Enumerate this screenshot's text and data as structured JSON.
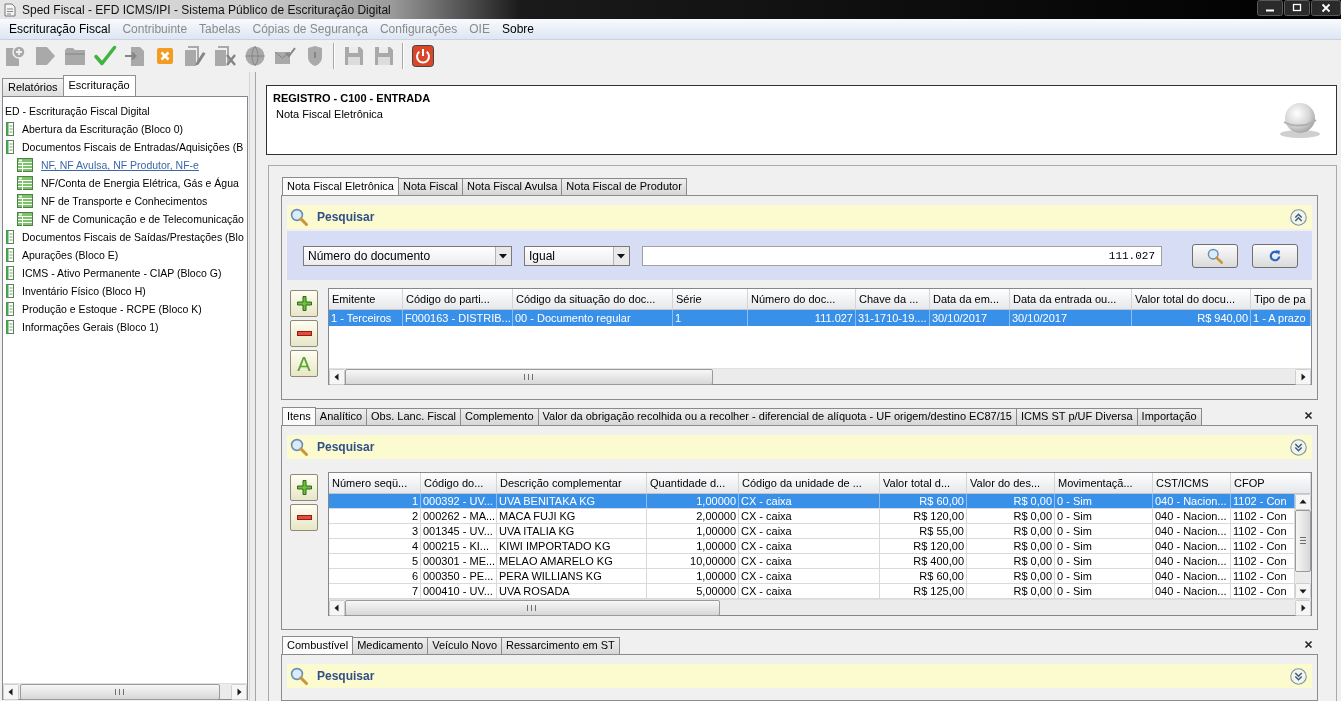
{
  "window": {
    "title": "Sped Fiscal - EFD ICMS/IPI - Sistema Público de Escrituração Digital"
  },
  "menu": [
    {
      "label": "Escrituração Fiscal",
      "disabled": false
    },
    {
      "label": "Contribuinte",
      "disabled": true
    },
    {
      "label": "Tabelas",
      "disabled": true
    },
    {
      "label": "Cópias de Segurança",
      "disabled": true
    },
    {
      "label": "Configurações",
      "disabled": true
    },
    {
      "label": "OIE",
      "disabled": true
    },
    {
      "label": "Sobre",
      "disabled": false
    }
  ],
  "toolbar": [
    {
      "buttons": [
        {
          "kind": "new",
          "disabled": true
        },
        {
          "kind": "forward",
          "disabled": true
        },
        {
          "kind": "folder",
          "disabled": true
        },
        {
          "kind": "check",
          "disabled": false
        },
        {
          "kind": "import",
          "disabled": true
        },
        {
          "kind": "cancel",
          "disabled": false
        },
        {
          "kind": "edit",
          "disabled": true
        },
        {
          "kind": "delete",
          "disabled": true
        },
        {
          "kind": "globe",
          "disabled": true
        },
        {
          "kind": "mail",
          "disabled": true
        },
        {
          "kind": "shield",
          "disabled": true
        }
      ]
    },
    {
      "buttons": [
        {
          "kind": "save",
          "disabled": true
        },
        {
          "kind": "save",
          "disabled": true
        }
      ]
    },
    {
      "buttons": [
        {
          "kind": "power",
          "disabled": false
        }
      ]
    }
  ],
  "left_panel": {
    "tabs": [
      {
        "label": "Relatórios",
        "selected": false
      },
      {
        "label": "Escrituração",
        "selected": true
      }
    ],
    "tree": [
      {
        "label": "ED - Escrituração Fiscal Digital",
        "selected": false,
        "children": [
          {
            "label": "Abertura da Escrituração (Bloco 0)",
            "selected": false
          },
          {
            "label": "Documentos Fiscais de Entradas/Aquisições (B",
            "selected": false,
            "children": [
              {
                "label": "NF, NF Avulsa, NF Produtor, NF-e",
                "selected": true
              },
              {
                "label": "NF/Conta de Energia Elétrica, Gás e Água",
                "selected": false
              },
              {
                "label": "NF de Transporte e Conhecimentos",
                "selected": false
              },
              {
                "label": "NF de Comunicação e de Telecomunicação",
                "selected": false
              }
            ]
          },
          {
            "label": "Documentos Fiscais de Saídas/Prestações (Blo",
            "selected": false
          },
          {
            "label": "Apurações (Bloco E)",
            "selected": false
          },
          {
            "label": "ICMS - Ativo Permanente - CIAP (Bloco G)",
            "selected": false
          },
          {
            "label": "Inventário Físico (Bloco H)",
            "selected": false
          },
          {
            "label": "Produção e Estoque - RCPE (Bloco K)",
            "selected": false
          },
          {
            "label": "Informações Gerais (Bloco 1)",
            "selected": false
          }
        ]
      }
    ]
  },
  "record_header": {
    "title": "REGISTRO - C100 - ENTRADA",
    "subtitle": "Nota Fiscal Eletrônica"
  },
  "document_section": {
    "tabs": [
      {
        "label": "Nota Fiscal Eletrônica",
        "selected": true
      },
      {
        "label": "Nota Fiscal",
        "selected": false
      },
      {
        "label": "Nota Fiscal Avulsa",
        "selected": false
      },
      {
        "label": "Nota Fiscal de Produtor",
        "selected": false
      }
    ],
    "search": {
      "label": "Pesquisar",
      "expanded": true,
      "field": "Número do documento",
      "operator": "Igual",
      "value": "111.027"
    },
    "row_buttons": [
      {
        "kind": "add"
      },
      {
        "kind": "remove"
      },
      {
        "kind": "letter",
        "label": "A"
      }
    ],
    "table": {
      "columns": [
        "Emitente",
        "Código do parti...",
        "Código da situação do doc...",
        "Série",
        "Número do doc...",
        "Chave da ...",
        "Data da em...",
        "Data da entrada ou...",
        "Valor total do docu...",
        "Tipo de pa"
      ],
      "rows": [
        {
          "selected": true,
          "cells": [
            "1 - Terceiros",
            "F000163 - DISTRIB...",
            "00 - Documento regular",
            "1",
            "111.027",
            "31-1710-19....",
            "30/10/2017",
            "30/10/2017",
            "R$ 940,00",
            "1 - A prazo"
          ]
        }
      ]
    }
  },
  "items_section": {
    "tabs": [
      {
        "label": "Itens",
        "selected": true
      },
      {
        "label": "Analítico",
        "selected": false
      },
      {
        "label": "Obs. Lanc. Fiscal",
        "selected": false
      },
      {
        "label": "Complemento",
        "selected": false
      },
      {
        "label": "Valor da obrigação recolhida ou a recolher - diferencial de alíquota - UF origem/destino EC87/15",
        "selected": false
      },
      {
        "label": "ICMS ST p/UF Diversa",
        "selected": false
      },
      {
        "label": "Importação",
        "selected": false
      }
    ],
    "search": {
      "label": "Pesquisar",
      "expanded": false
    },
    "row_buttons": [
      {
        "kind": "add"
      },
      {
        "kind": "remove"
      }
    ],
    "table": {
      "columns": [
        "Número seqü...",
        "Código do...",
        "Descrição complementar",
        "Quantidade d...",
        "Código da unidade de ...",
        "Valor total d...",
        "Valor do des...",
        "Movimentaçã...",
        "CST/ICMS",
        "CFOP"
      ],
      "rows": [
        {
          "selected": true,
          "cells": [
            "1",
            "000392 - UV...",
            "UVA BENITAKA KG",
            "1,00000",
            "CX - caixa",
            "R$ 60,00",
            "R$ 0,00",
            "0 - Sim",
            "040 - Nacion...",
            "1102 - Con"
          ]
        },
        {
          "selected": false,
          "cells": [
            "2",
            "000262 - MA...",
            "MACA FUJI KG",
            "2,00000",
            "CX - caixa",
            "R$ 120,00",
            "R$ 0,00",
            "0 - Sim",
            "040 - Nacion...",
            "1102 - Con"
          ]
        },
        {
          "selected": false,
          "cells": [
            "3",
            "001345 - UV...",
            "UVA ITALIA KG",
            "1,00000",
            "CX - caixa",
            "R$ 55,00",
            "R$ 0,00",
            "0 - Sim",
            "040 - Nacion...",
            "1102 - Con"
          ]
        },
        {
          "selected": false,
          "cells": [
            "4",
            "000215 - KI...",
            "KIWI IMPORTADO KG",
            "1,00000",
            "CX - caixa",
            "R$ 120,00",
            "R$ 0,00",
            "0 - Sim",
            "040 - Nacion...",
            "1102 - Con"
          ]
        },
        {
          "selected": false,
          "cells": [
            "5",
            "000301 - ME...",
            "MELAO AMARELO KG",
            "10,00000",
            "CX - caixa",
            "R$ 400,00",
            "R$ 0,00",
            "0 - Sim",
            "040 - Nacion...",
            "1102 - Con"
          ]
        },
        {
          "selected": false,
          "cells": [
            "6",
            "000350 - PE...",
            "PERA WILLIANS KG",
            "1,00000",
            "CX - caixa",
            "R$ 60,00",
            "R$ 0,00",
            "0 - Sim",
            "040 - Nacion...",
            "1102 - Con"
          ]
        },
        {
          "selected": false,
          "cells": [
            "7",
            "000410 - UV...",
            "UVA ROSADA",
            "5,00000",
            "CX - caixa",
            "R$ 125,00",
            "R$ 0,00",
            "0 - Sim",
            "040 - Nacion...",
            "1102 - Con"
          ]
        }
      ]
    }
  },
  "detail_section": {
    "tabs": [
      {
        "label": "Combustível",
        "selected": true
      },
      {
        "label": "Medicamento",
        "selected": false
      },
      {
        "label": "Veículo Novo",
        "selected": false
      },
      {
        "label": "Ressarcimento em ST",
        "selected": false
      }
    ],
    "search": {
      "label": "Pesquisar",
      "expanded": false
    }
  }
}
